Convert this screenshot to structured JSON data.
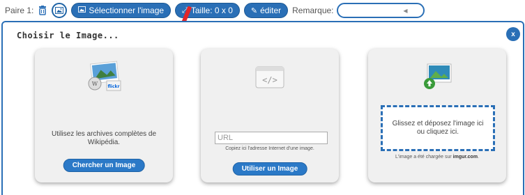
{
  "toolbar": {
    "pair_label": "Paire 1:",
    "select_image_label": "Sélectionner l'image",
    "size_label": "Taille: 0 x 0",
    "edit_label": "éditer",
    "remark_label": "Remarque:",
    "remark_value": ""
  },
  "dialog": {
    "title": "Choisir le Image...",
    "close_label": "x",
    "cards": [
      {
        "text": "Utilisez les archives complètes de Wikipédia.",
        "button": "Chercher un Image"
      },
      {
        "url_placeholder": "URL",
        "hint": "Copiez ici l'adresse Internet d'une image.",
        "button": "Utiliser un Image"
      },
      {
        "dropzone_text": "Glissez et déposez l'image ici ou cliquez ici.",
        "note_prefix": "L'image a été chargée sur",
        "note_site": "imgur.com",
        "note_suffix": "."
      }
    ]
  },
  "colors": {
    "accent": "#2a6fb6",
    "annotation": "#e3262a"
  }
}
